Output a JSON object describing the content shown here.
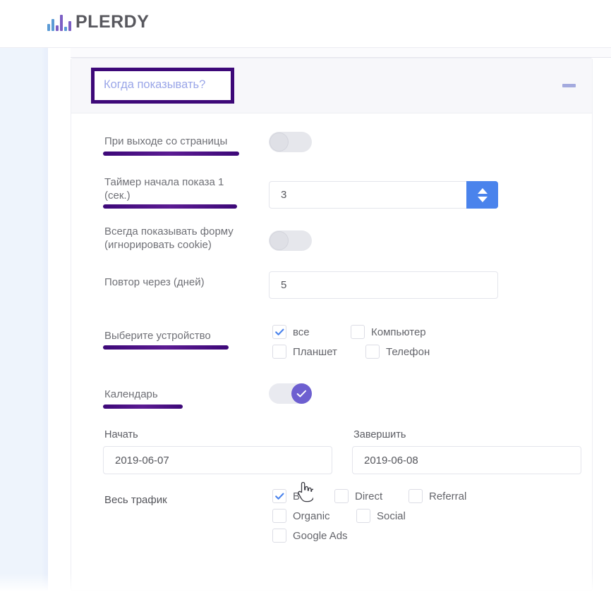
{
  "brand": {
    "name": "PLERDY",
    "logo_icon": "bar-chart-logo-icon"
  },
  "section": {
    "title": "Когда показывать?",
    "collapse_icon": "minus-icon",
    "title_highlight_color": "#3d0878",
    "title_text_color": "#9aa6e8"
  },
  "rows": {
    "exit_intent": {
      "label": "При выходе со страницы",
      "toggle_state": "off",
      "underlined": true
    },
    "timer": {
      "label": "Таймер начала показа 1 (сек.)",
      "value": "3",
      "underlined": true,
      "spinner_color": "#4a83ec"
    },
    "always_show": {
      "label": "Всегда показывать форму (игнорировать cookie)",
      "toggle_state": "off",
      "underlined": false
    },
    "repeat_days": {
      "label": "Повтор через (дней)",
      "value": "5",
      "underlined": false
    },
    "device": {
      "label": "Выберите устройство",
      "underlined": true,
      "options": [
        {
          "label": "все",
          "checked": true
        },
        {
          "label": "Компьютер",
          "checked": false
        },
        {
          "label": "Планшет",
          "checked": false
        },
        {
          "label": "Телефон",
          "checked": false
        }
      ]
    },
    "calendar": {
      "label": "Календарь",
      "toggle_state": "on",
      "underlined": true,
      "knob_color": "#6d5fd0",
      "knob_icon": "check-icon"
    },
    "dates": {
      "start_label": "Начать",
      "start_value": "2019-06-07",
      "end_label": "Завершить",
      "end_value": "2019-06-08"
    },
    "traffic": {
      "label": "Весь трафик",
      "underlined": false,
      "options": [
        {
          "label": "Все",
          "checked": true
        },
        {
          "label": "Direct",
          "checked": false
        },
        {
          "label": "Referral",
          "checked": false
        },
        {
          "label": "Organic",
          "checked": false
        },
        {
          "label": "Social",
          "checked": false
        },
        {
          "label": "Google Ads",
          "checked": false
        }
      ]
    }
  },
  "cursor": {
    "icon": "pointing-hand-cursor"
  }
}
